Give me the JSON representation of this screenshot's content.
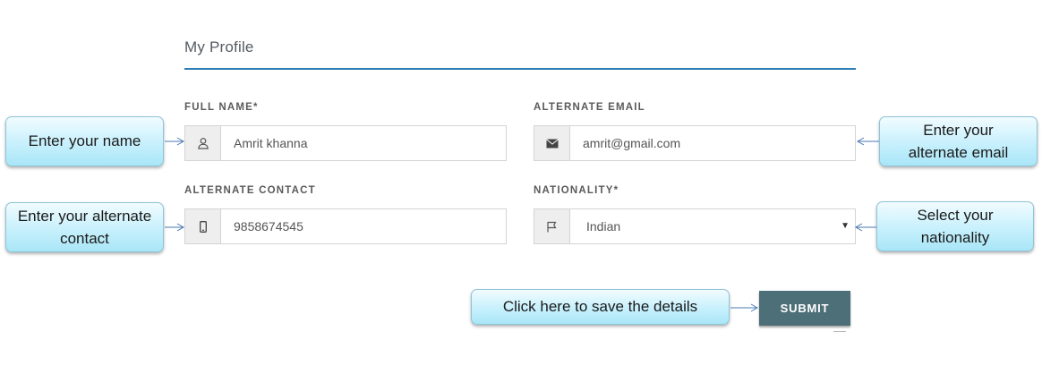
{
  "form": {
    "title": "My Profile",
    "full_name": {
      "label": "FULL NAME*",
      "value": "Amrit khanna",
      "icon": "user-icon"
    },
    "alternate_email": {
      "label": "ALTERNATE EMAIL",
      "value": "amrit@gmail.com",
      "icon": "envelope-icon"
    },
    "alternate_contact": {
      "label": "ALTERNATE CONTACT",
      "value": "9858674545",
      "icon": "phone-icon"
    },
    "nationality": {
      "label": "NATIONALITY*",
      "value": "Indian",
      "icon": "flag-icon"
    },
    "submit_label": "SUBMIT"
  },
  "callouts": {
    "name": "Enter your name",
    "email": "Enter your alternate email",
    "contact": "Enter your alternate contact",
    "nationality": "Select your nationality",
    "submit": "Click here to save the details"
  },
  "colors": {
    "accent_rule": "#2e7db4",
    "submit_bg": "#4d6f77",
    "callout_border": "#8fc3d6",
    "arrow": "#4a7ab5"
  }
}
